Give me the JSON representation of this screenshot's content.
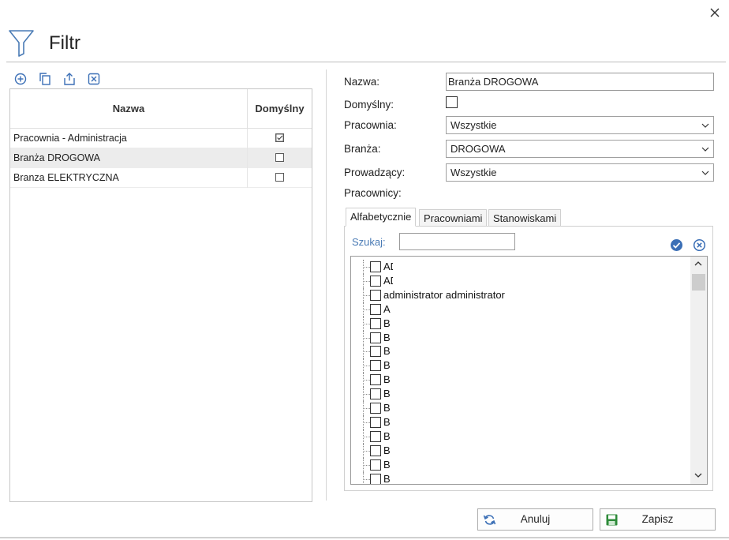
{
  "window": {
    "title": "Filtr"
  },
  "grid": {
    "headers": {
      "name": "Nazwa",
      "default": "Domyślny"
    },
    "rows": [
      {
        "name": "Pracownia - Administracja",
        "default": true
      },
      {
        "name": "Branża DROGOWA",
        "default": false,
        "selected": true
      },
      {
        "name": "Branza ELEKTRYCZNA",
        "default": false
      }
    ]
  },
  "form": {
    "name_label": "Nazwa:",
    "name_value": "Branża DROGOWA",
    "default_label": "Domyślny:",
    "default_checked": false,
    "pracownia_label": "Pracownia:",
    "pracownia_value": "Wszystkie",
    "branza_label": "Branża:",
    "branza_value": "DROGOWA",
    "prowadzacy_label": "Prowadzący:",
    "prowadzacy_value": "Wszystkie",
    "pracownicy_label": "Pracownicy:"
  },
  "tabs": [
    {
      "label": "Alfabetycznie",
      "active": true
    },
    {
      "label": "Pracowniami",
      "active": false
    },
    {
      "label": "Stanowiskami",
      "active": false
    }
  ],
  "search": {
    "label": "Szukaj:",
    "value": ""
  },
  "employees": [
    "AD",
    "AD",
    "administrator administrator",
    "A",
    "B",
    "B",
    "B",
    "B",
    "B",
    "B",
    "B",
    "B",
    "B",
    "B",
    "B",
    "B"
  ],
  "buttons": {
    "cancel": "Anuluj",
    "save": "Zapisz"
  },
  "colors": {
    "accent": "#4a7bb5",
    "icon_blue": "#3b6fb6",
    "save_green": "#2e8b3a"
  }
}
